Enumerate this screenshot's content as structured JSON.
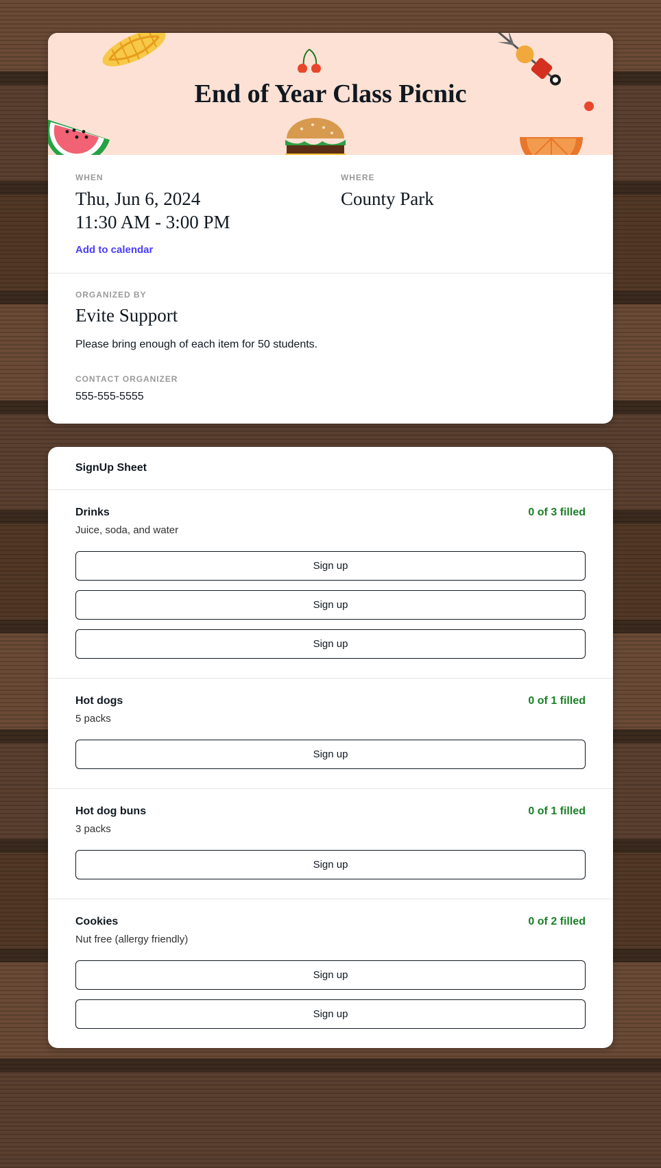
{
  "event": {
    "title": "End of Year Class Picnic",
    "when_label": "WHEN",
    "date": "Thu, Jun 6, 2024",
    "time": "11:30 AM - 3:00 PM",
    "add_calendar": "Add to calendar",
    "where_label": "WHERE",
    "location": "County Park",
    "organized_by_label": "ORGANIZED BY",
    "organizer": "Evite Support",
    "note": "Please bring enough of each item for 50 students.",
    "contact_label": "CONTACT ORGANIZER",
    "contact_phone": "555-555-5555"
  },
  "signup": {
    "sheet_title": "SignUp Sheet",
    "button_label": "Sign up",
    "items": [
      {
        "name": "Drinks",
        "description": "Juice, soda, and water",
        "fill_status": "0 of 3 filled",
        "slots": 3
      },
      {
        "name": "Hot dogs",
        "description": "5 packs",
        "fill_status": "0 of 1 filled",
        "slots": 1
      },
      {
        "name": "Hot dog buns",
        "description": "3 packs",
        "fill_status": "0 of 1 filled",
        "slots": 1
      },
      {
        "name": "Cookies",
        "description": "Nut free (allergy friendly)",
        "fill_status": "0 of 2 filled",
        "slots": 2
      }
    ]
  }
}
